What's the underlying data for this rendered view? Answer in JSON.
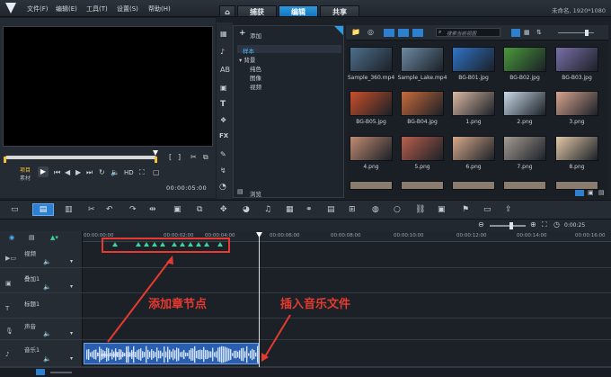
{
  "menu": {
    "items": [
      "文件(F)",
      "编辑(E)",
      "工具(T)",
      "设置(S)",
      "帮助(H)"
    ]
  },
  "tabs": [
    {
      "label": "捕获",
      "active": false
    },
    {
      "label": "编辑",
      "active": true
    },
    {
      "label": "共享",
      "active": false
    }
  ],
  "project": {
    "name": "未命名",
    "resolution": "1920*1080"
  },
  "preview": {
    "project_label": "项目",
    "clip_label": "素材",
    "hd": "HD",
    "timecode": "00:00:05:00"
  },
  "library": {
    "add_label": "添加",
    "tree": [
      "样本",
      "背景",
      "纯色",
      "图像",
      "视频"
    ],
    "search_placeholder": "搜索当前视图",
    "browse_label": "浏览",
    "thumbnails": [
      {
        "label": "Sample_360.mp4",
        "color": "#4e6f8c"
      },
      {
        "label": "Sample_Lake.mp4",
        "color": "#6d8aa3"
      },
      {
        "label": "BG-B01.jpg",
        "color": "#2f74c6"
      },
      {
        "label": "BG-B02.jpg",
        "color": "#4a9a3a"
      },
      {
        "label": "BG-B03.jpg",
        "color": "#7a6fa8"
      },
      {
        "label": "BG-B05.jpg",
        "color": "#c8502a"
      },
      {
        "label": "BG-B04.jpg",
        "color": "#c86a3a"
      },
      {
        "label": "1.png",
        "color": "#d9b7a3"
      },
      {
        "label": "2.png",
        "color": "#c7d8e6"
      },
      {
        "label": "3.png",
        "color": "#d6a48e"
      },
      {
        "label": "4.png",
        "color": "#c08b72"
      },
      {
        "label": "5.png",
        "color": "#b95f4d"
      },
      {
        "label": "6.png",
        "color": "#d6a88a"
      },
      {
        "label": "7.png",
        "color": "#a59b92"
      },
      {
        "label": "8.png",
        "color": "#e2c8a8"
      }
    ]
  },
  "timeline": {
    "zoom_time": "0:00:25",
    "ruler": [
      "00:00:00:00",
      "00:00:02:00",
      "00:00:04:00",
      "00:00:06:00",
      "00:00:08:00",
      "00:00:10:00",
      "00:00:12:00",
      "00:00:14:00",
      "00:00:16:00"
    ],
    "tracks": [
      {
        "label": "视频"
      },
      {
        "label": "叠加1"
      },
      {
        "label": "标题1"
      },
      {
        "label": "声音"
      },
      {
        "label": "音乐1"
      }
    ],
    "audio_clip_label": "Sample插入音乐"
  },
  "annotations": {
    "chapter": "添加章节点",
    "music": "插入音乐文件"
  }
}
